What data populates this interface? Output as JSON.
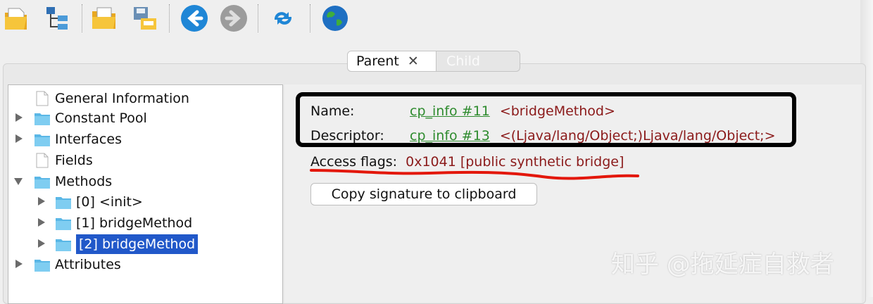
{
  "toolbar": {
    "buttons": [
      {
        "name": "open-file-icon",
        "interactable": true
      },
      {
        "name": "hierarchy-icon",
        "interactable": true
      },
      {
        "name": "open-folder-icon",
        "interactable": true
      },
      {
        "name": "save-icon",
        "interactable": true
      },
      {
        "name": "back-icon",
        "interactable": true
      },
      {
        "name": "forward-icon",
        "interactable": false
      },
      {
        "name": "refresh-icon",
        "interactable": true
      },
      {
        "name": "globe-icon",
        "interactable": true
      }
    ]
  },
  "tabs": {
    "parent": "Parent",
    "close": "✕",
    "child": "Child"
  },
  "tree": {
    "general_information": "General Information",
    "constant_pool": "Constant Pool",
    "interfaces": "Interfaces",
    "fields": "Fields",
    "methods": "Methods",
    "method_0": "[0] <init>",
    "method_1": "[1] bridgeMethod",
    "method_2": "[2] bridgeMethod",
    "attributes": "Attributes",
    "selected": "[2] bridgeMethod"
  },
  "details": {
    "name_label": "Name:",
    "name_link": "cp_info #11",
    "name_value": "<bridgeMethod>",
    "descriptor_label": "Descriptor:",
    "descriptor_link": "cp_info #13",
    "descriptor_value": "<(Ljava/lang/Object;)Ljava/lang/Object;>",
    "access_label": "Access flags:",
    "access_value": "0x1041 [public synthetic bridge]",
    "copy_button": "Copy signature to clipboard"
  },
  "colors": {
    "link": "#2e8b2e",
    "value": "#8b1a1a",
    "selection": "#2158c9",
    "folder": "#5ab7e6",
    "annotation_red": "#e3170a"
  },
  "watermark": "知乎 @拖延症自救者"
}
